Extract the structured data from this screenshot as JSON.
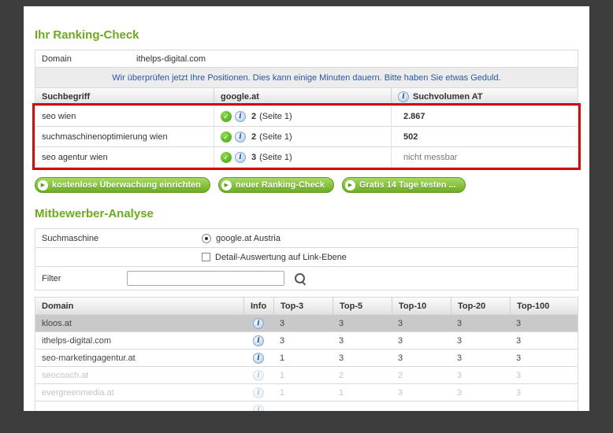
{
  "colors": {
    "accent_green": "#6caa1e",
    "highlight_red": "#cf0f0f",
    "status_blue": "#2b57a5"
  },
  "icons": {
    "check": "✓",
    "info": "i",
    "play": "▶"
  },
  "ranking": {
    "title": "Ihr Ranking-Check",
    "domain_label": "Domain",
    "domain_value": "ithelps-digital.com",
    "status_message": "Wir überprüfen jetzt Ihre Positionen. Dies kann einige Minuten dauern. Bitte haben Sie etwas Geduld.",
    "headers": [
      "Suchbegriff",
      "google.at",
      "Suchvolumen AT"
    ],
    "rows": [
      {
        "keyword": "seo wien",
        "position": "2",
        "position_suffix": "(Seite 1)",
        "volume": "2.867"
      },
      {
        "keyword": "suchmaschinenoptimierung wien",
        "position": "2",
        "position_suffix": "(Seite 1)",
        "volume": "502"
      },
      {
        "keyword": "seo agentur wien",
        "position": "3",
        "position_suffix": "(Seite 1)",
        "volume": "nicht messbar"
      }
    ],
    "buttons": [
      "kostenlose Überwachung einrichten",
      "neuer Ranking-Check",
      "Gratis 14 Tage testen ..."
    ]
  },
  "competitors": {
    "title": "Mitbewerber-Analyse",
    "search_engine_label": "Suchmaschine",
    "search_engine_option": "google.at Austria",
    "detail_option": "Detail-Auswertung auf Link-Ebene",
    "filter_label": "Filter",
    "headers": [
      "Domain",
      "Info",
      "Top-3",
      "Top-5",
      "Top-10",
      "Top-20",
      "Top-100"
    ],
    "rows": [
      {
        "domain": "kloos.at",
        "values": [
          "3",
          "3",
          "3",
          "3",
          "3"
        ]
      },
      {
        "domain": "ithelps-digital.com",
        "values": [
          "3",
          "3",
          "3",
          "3",
          "3"
        ]
      },
      {
        "domain": "seo-marketingagentur.at",
        "values": [
          "1",
          "3",
          "3",
          "3",
          "3"
        ]
      },
      {
        "domain": "seocoach.at",
        "values": [
          "1",
          "2",
          "2",
          "3",
          "3"
        ]
      },
      {
        "domain": "evergreenmedia.at",
        "values": [
          "1",
          "1",
          "3",
          "3",
          "3"
        ]
      },
      {
        "domain": "",
        "values": [
          "",
          "",
          "",
          "",
          ""
        ]
      }
    ]
  }
}
